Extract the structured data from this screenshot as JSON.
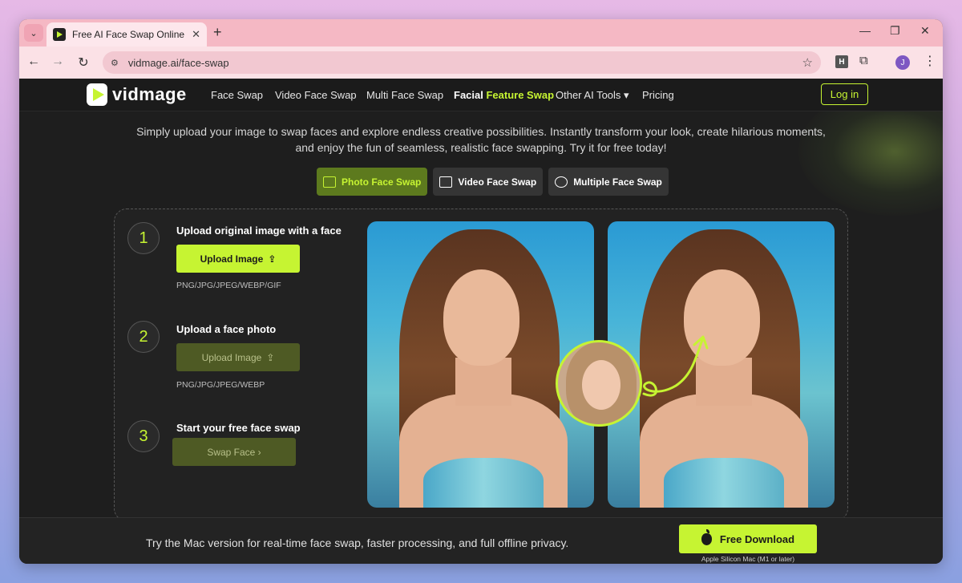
{
  "browser": {
    "tab_title": "Free AI Face Swap Online for Ph",
    "tab_close": "✕",
    "new_tab": "+",
    "url": "vidmage.ai/face-swap",
    "avatar_letter": "J",
    "ext_letter": "H",
    "icons": [
      "tab-search-icon",
      "favicon-icon",
      "close-icon",
      "back-arrow-icon",
      "forward-arrow-icon",
      "reload-icon",
      "site-info-icon",
      "star-icon",
      "extension-icon",
      "puzzle-icon",
      "more-menu-icon",
      "minimize-icon",
      "maximize-icon",
      "window-close-icon"
    ]
  },
  "site_nav": {
    "logo_text": "vidmage",
    "items": [
      "Face Swap",
      "Video Face Swap",
      "Multi Face Swap"
    ],
    "feature_part1": "Facial",
    "feature_part2": "Feature Swap",
    "other_tools": "Other AI Tools ▾",
    "pricing": "Pricing",
    "login": "Log in"
  },
  "intro": {
    "line1": "Simply upload your image to swap faces and explore endless creative possibilities. Instantly transform your look, create hilarious moments,",
    "line2": "and enjoy the fun of seamless, realistic face swapping. Try it for free today!"
  },
  "mode_tabs": [
    {
      "label": "Photo Face Swap",
      "icon": "image-icon",
      "active": true
    },
    {
      "label": "Video Face Swap",
      "icon": "play-icon",
      "active": false
    },
    {
      "label": "Multiple Face Swap",
      "icon": "users-icon",
      "active": false
    }
  ],
  "steps": [
    {
      "num": "1",
      "title": "Upload original image with a face",
      "button": "Upload Image",
      "formats": "PNG/JPG/JPEG/WEBP/GIF"
    },
    {
      "num": "2",
      "title": "Upload a face photo",
      "button": "Upload Image",
      "formats": "PNG/JPG/JPEG/WEBP"
    },
    {
      "num": "3",
      "title": "Start your free face swap",
      "button": "Swap Face ›"
    }
  ],
  "banner": {
    "text": "Try the Mac version for real-time face swap, faster processing, and full offline privacy.",
    "button": "Free Download",
    "note": "Apple Silicon Mac (M1 or later)"
  },
  "colors": {
    "accent": "#c6f432",
    "dark_bg": "#1e1e1e",
    "active_tab_bg": "#5d7a1e",
    "disabled_btn_bg": "#4e5a24"
  }
}
